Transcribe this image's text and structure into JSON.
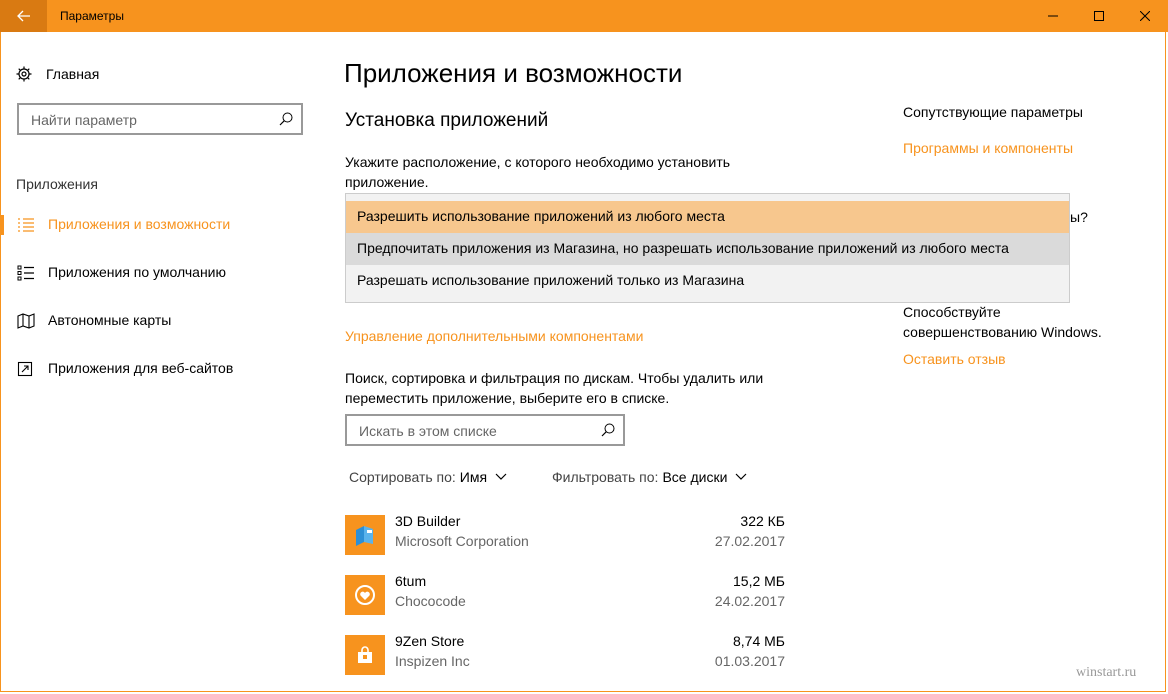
{
  "window": {
    "title": "Параметры",
    "accent": "#f7931e"
  },
  "sidebar": {
    "home_label": "Главная",
    "search_placeholder": "Найти параметр",
    "section_label": "Приложения",
    "items": [
      {
        "label": "Приложения и возможности",
        "icon": "apps-features-icon",
        "active": true
      },
      {
        "label": "Приложения по умолчанию",
        "icon": "default-apps-icon",
        "active": false
      },
      {
        "label": "Автономные карты",
        "icon": "map-icon",
        "active": false
      },
      {
        "label": "Приложения для веб-сайтов",
        "icon": "web-apps-icon",
        "active": false
      }
    ]
  },
  "main": {
    "title": "Приложения и возможности",
    "install_heading": "Установка приложений",
    "install_desc_line1": "Укажите расположение, с которого необходимо установить",
    "install_desc_line2": "приложение.",
    "dropdown_options": [
      "Разрешить использование приложений из любого места",
      "Предпочитать приложения из Магазина, но разрешать использование приложений из любого места",
      "Разрешать использование приложений только из Магазина"
    ],
    "manage_link": "Управление дополнительными компонентами",
    "search_desc_line1": "Поиск, сортировка и фильтрация по дискам. Чтобы удалить или",
    "search_desc_line2": "переместить приложение, выберите его в списке.",
    "list_search_placeholder": "Искать в этом списке",
    "sort_label": "Сортировать по:",
    "sort_value": "Имя",
    "filter_label": "Фильтровать по:",
    "filter_value": "Все диски",
    "apps": [
      {
        "name": "3D Builder",
        "publisher": "Microsoft Corporation",
        "size": "322 КБ",
        "date": "27.02.2017",
        "icon": "3d-builder-icon"
      },
      {
        "name": "6tum",
        "publisher": "Chococode",
        "size": "15,2 МБ",
        "date": "24.02.2017",
        "icon": "6tum-icon"
      },
      {
        "name": "9Zen Store",
        "publisher": "Inspizen Inc",
        "size": "8,74 МБ",
        "date": "01.03.2017",
        "icon": "shopping-bag-icon"
      }
    ]
  },
  "right": {
    "related_heading": "Сопутствующие параметры",
    "programs_link": "Программы и компоненты",
    "question_fragment": "ы?",
    "feedback_line1": "Способствуйте",
    "feedback_line2": "совершенствованию Windows.",
    "feedback_link": "Оставить отзыв"
  },
  "watermark": "winstart.ru"
}
